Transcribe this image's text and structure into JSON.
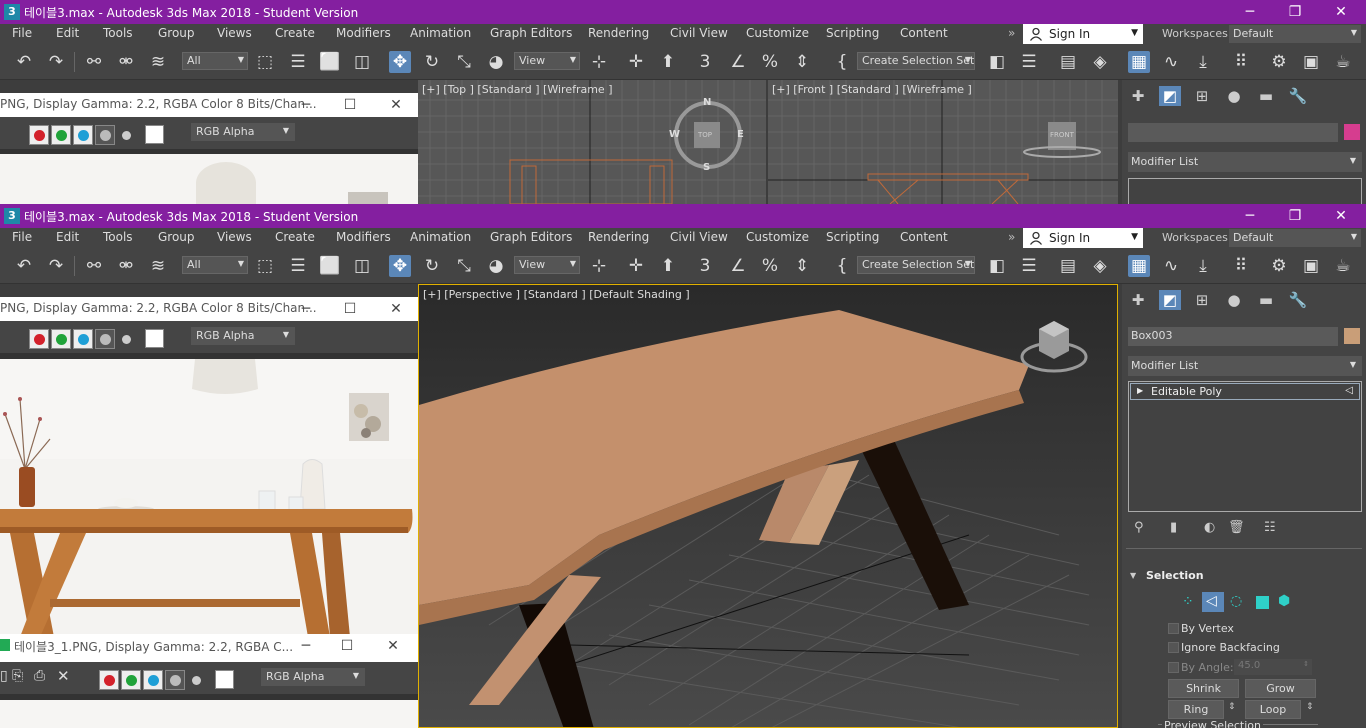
{
  "app": {
    "title": "테이블3.max - Autodesk 3ds Max 2018 - Student Version",
    "icon_label": "3",
    "window_buttons": [
      "─",
      "❐",
      "✕"
    ]
  },
  "menu": {
    "items": [
      "File",
      "Edit",
      "Tools",
      "Group",
      "Views",
      "Create",
      "Modifiers",
      "Animation",
      "Graph Editors",
      "Rendering",
      "Civil View",
      "Customize",
      "Scripting",
      "Content"
    ],
    "overflow": "»",
    "sign_in": "Sign In",
    "workspaces_label": "Workspaces:",
    "workspaces_value": "Default"
  },
  "toolbar": {
    "filter_value": "All",
    "view_value": "View",
    "selection_set_placeholder": "Create Selection Set"
  },
  "frames": {
    "f1_title": "PNG, Display Gamma: 2.2, RGBA Color 8 Bits/Chan...",
    "f2_title": "테이블3_1.PNG, Display Gamma: 2.2, RGBA C...",
    "channel_value": "RGB Alpha",
    "frame_buttons": [
      "─",
      "☐",
      "✕"
    ]
  },
  "viewports": {
    "top_label": "[+] [Top ] [Standard ] [Wireframe ]",
    "front_label": "[+] [Front ] [Standard ] [Wireframe ]",
    "persp_label": "[+] [Perspective ] [Standard ] [Default Shading ]",
    "compass": {
      "n": "N",
      "s": "S",
      "e": "E",
      "w": "W"
    },
    "cube_top": "TOP",
    "cube_front": "FRONT"
  },
  "command_panel": {
    "object_name_top": "",
    "object_name": "Box003",
    "modifier_list": "Modifier List",
    "stack_item": "Editable Poly",
    "swatch_color_top": "#d63d8f",
    "swatch_color": "#c99e78",
    "selection_title": "Selection",
    "by_vertex": "By Vertex",
    "ignore_backfacing": "Ignore Backfacing",
    "by_angle": "By Angle:",
    "by_angle_value": "45.0",
    "shrink": "Shrink",
    "grow": "Grow",
    "ring": "Ring",
    "loop": "Loop",
    "preview_selection": "Preview Selection"
  },
  "colors": {
    "title_bar": "#841fa0",
    "accent_blue": "#5b87b8",
    "table_wood": "#c99470",
    "channel_red": "#d3212b",
    "channel_green": "#20a33a",
    "channel_blue": "#1e9fd6"
  }
}
